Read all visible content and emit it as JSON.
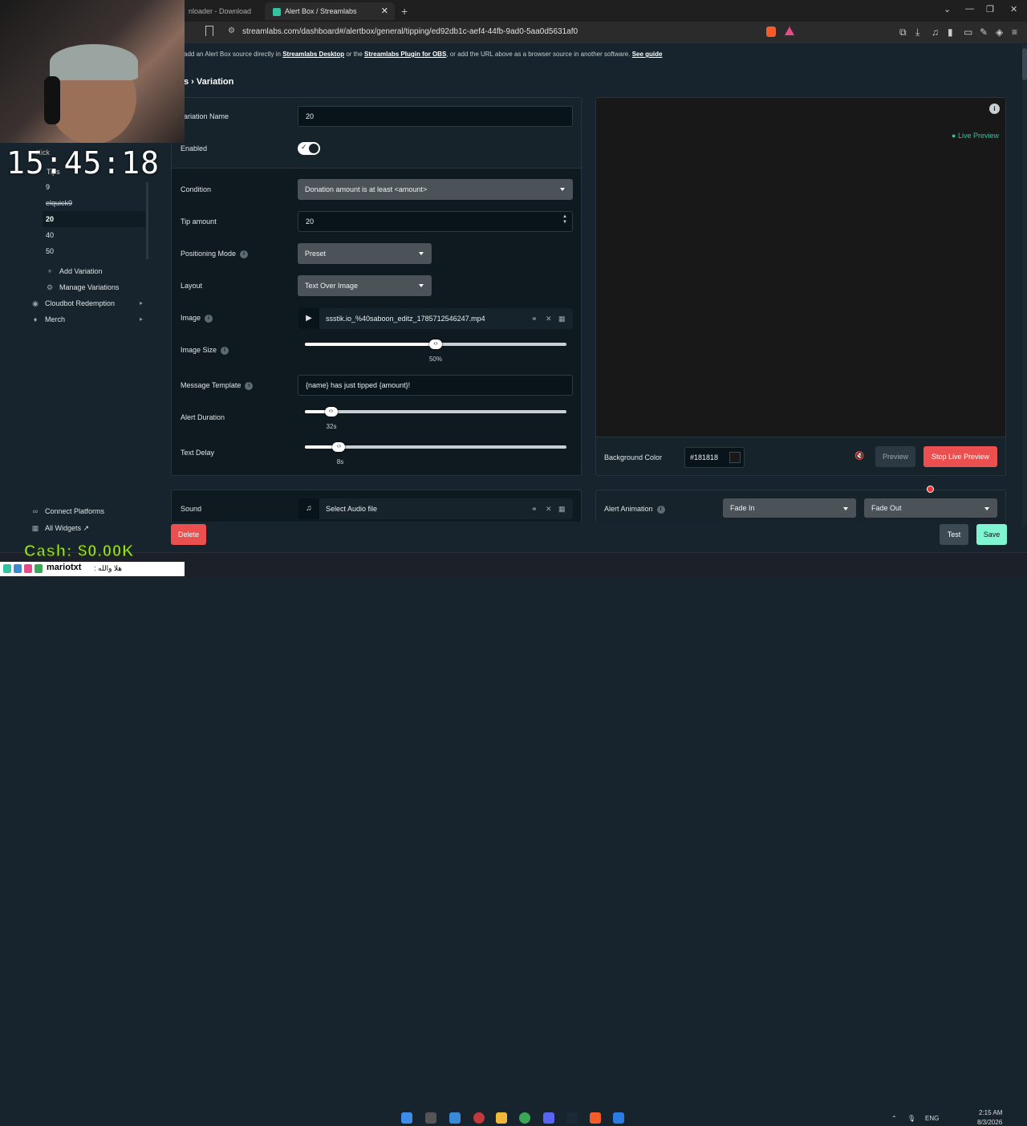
{
  "browser": {
    "tabs": [
      {
        "label": "nloader - Download TikTo",
        "active": false
      },
      {
        "label": "Alert Box / Streamlabs",
        "active": true
      }
    ],
    "new_tab": "+",
    "url": "streamlabs.com/dashboard#/alertbox/general/tipping/ed92db1c-aef4-44fb-9ad0-5aa0d5631af0"
  },
  "info_line": {
    "prefix": "add an Alert Box source directly in",
    "link1": "Streamlabs Desktop",
    "mid": "or the",
    "link2": "Streamlabs Plugin for OBS",
    "suffix": ", or add the URL above as a browser source in another software.",
    "link3": "See guide"
  },
  "breadcrumb": "s › Variation",
  "stream_overlay": {
    "clock": "15:45:18",
    "cash": "Cash: $0.00K",
    "chat_user": "mariotxt",
    "chat_msg": ": هلا والله"
  },
  "sidebar": {
    "kick": "Kick",
    "tips": "Tips",
    "variations": [
      "9",
      "elquick9",
      "20",
      "40",
      "50"
    ],
    "selected": "20",
    "add_variation": "Add Variation",
    "manage_variations": "Manage Variations",
    "cloudbot": "Cloudbot Redemption",
    "merch": "Merch",
    "connect": "Connect Platforms",
    "all_widgets": "All Widgets"
  },
  "form": {
    "variation_name_label": "ariation Name",
    "variation_name": "20",
    "enabled_label": "Enabled",
    "enabled": true,
    "condition_label": "Condition",
    "condition": "Donation amount is at least <amount>",
    "tip_amount_label": "Tip amount",
    "tip_amount": "20",
    "positioning_label": "Positioning Mode",
    "positioning": "Preset",
    "layout_label": "Layout",
    "layout": "Text Over Image",
    "image_label": "Image",
    "image_file": "ssstik.io_%40saboon_editz_1785712546247.mp4",
    "image_size_label": "Image Size",
    "image_size": "50%",
    "image_size_value": 0.5,
    "message_template_label": "Message Template",
    "message_template": "{name} has just tipped {amount}!",
    "alert_duration_label": "Alert Duration",
    "alert_duration": "32s",
    "alert_duration_value": 0.1,
    "text_delay_label": "Text Delay",
    "text_delay": "8s",
    "text_delay_value": 0.13,
    "sound_label": "Sound",
    "sound_file": "Select Audio file"
  },
  "preview": {
    "live_preview": "Live Preview",
    "background_color_label": "Background Color",
    "background_color": "#181818",
    "preview_btn": "Preview",
    "stop_btn": "Stop Live Preview",
    "alert_animation_label": "Alert Animation",
    "anim_in": "Fade In",
    "anim_out": "Fade Out"
  },
  "actions": {
    "delete": "Delete",
    "test": "Test",
    "save": "Save"
  },
  "taskbar": {
    "lang": "ENG",
    "time": "2:15 AM",
    "date": "8/3/2026"
  },
  "colors": {
    "accent": "#31c3a2",
    "danger": "#eb4f4f",
    "save": "#80f5d2",
    "panel": "#16232b"
  }
}
